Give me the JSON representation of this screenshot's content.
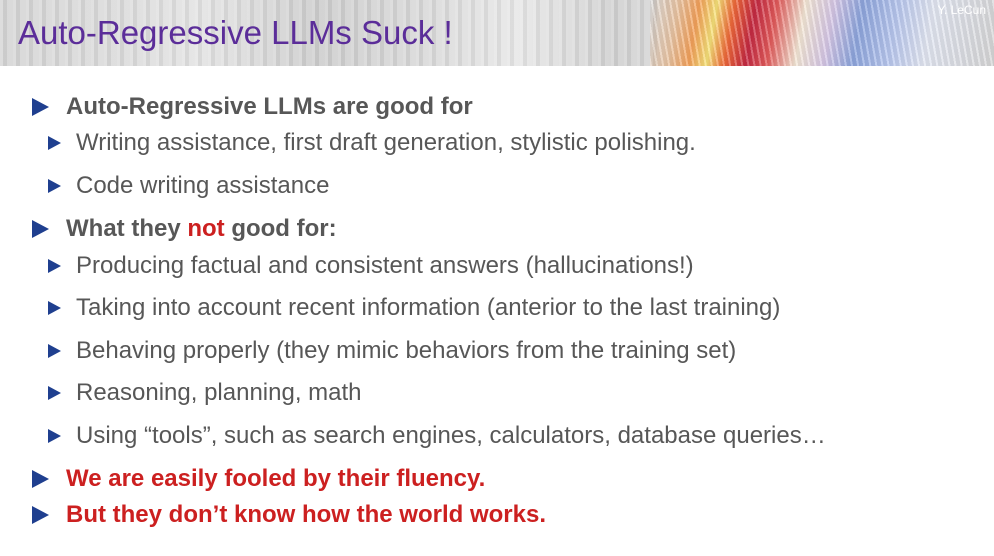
{
  "slide": {
    "title": "Auto-Regressive LLMs Suck !",
    "author": "Y. LeCun"
  },
  "bullets": {
    "good_for_heading": "Auto-Regressive LLMs are good for",
    "good_for": [
      "Writing assistance, first draft generation, stylistic polishing.",
      "Code writing assistance"
    ],
    "not_good_for_heading_before": "What they ",
    "not_good_for_heading_highlight": "not",
    "not_good_for_heading_after": " good for:",
    "not_good_for": [
      "Producing factual and consistent answers (hallucinations!)",
      "Taking into account recent information (anterior to the last training)",
      "Behaving properly (they mimic behaviors from the training set)",
      "Reasoning, planning, math",
      "Using “tools”, such as search engines, calculators, database queries…"
    ],
    "conclusion_1": "We are easily fooled by their fluency.",
    "conclusion_2": "But they don’t know how the world works."
  },
  "colors": {
    "title": "#5b2d99",
    "body_text": "#575757",
    "highlight_red": "#cc2020",
    "bullet_arrow": "#1f3f8f"
  },
  "icons": {
    "bullet": "play-triangle-icon"
  }
}
